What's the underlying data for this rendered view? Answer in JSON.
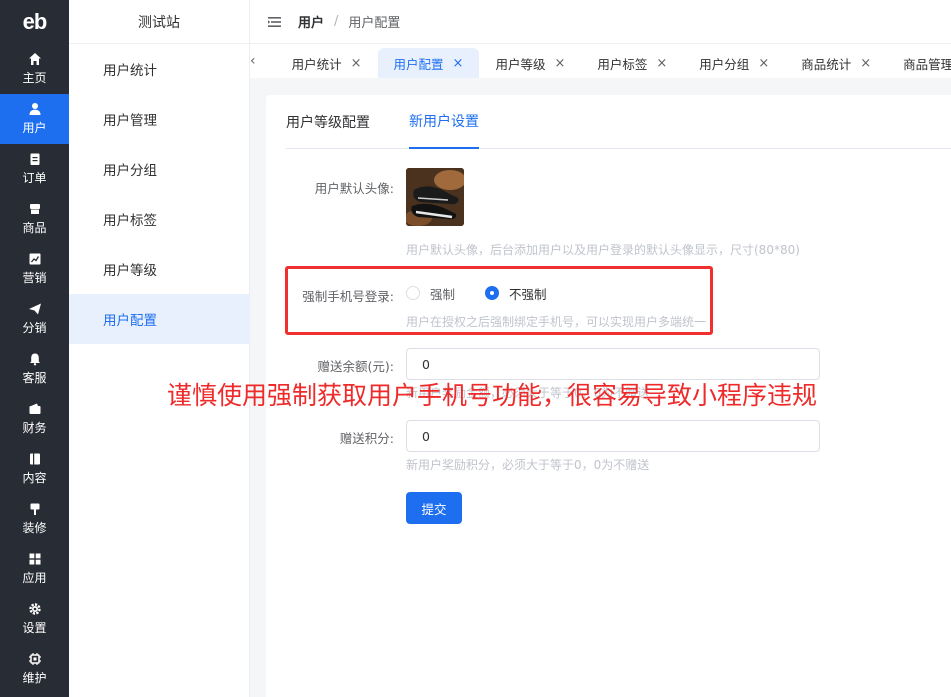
{
  "logo": {
    "text": "eb"
  },
  "rail": {
    "items": [
      {
        "label": "主页",
        "icon": "home-icon"
      },
      {
        "label": "用户",
        "icon": "user-icon",
        "active": true
      },
      {
        "label": "订单",
        "icon": "clipboard-icon"
      },
      {
        "label": "商品",
        "icon": "box-icon"
      },
      {
        "label": "营销",
        "icon": "chart-icon"
      },
      {
        "label": "分销",
        "icon": "send-icon"
      },
      {
        "label": "客服",
        "icon": "bell-icon"
      },
      {
        "label": "财务",
        "icon": "wallet-icon"
      },
      {
        "label": "内容",
        "icon": "book-icon"
      },
      {
        "label": "装修",
        "icon": "brush-icon"
      },
      {
        "label": "应用",
        "icon": "grid-icon"
      },
      {
        "label": "设置",
        "icon": "gear-icon"
      },
      {
        "label": "维护",
        "icon": "chip-icon"
      }
    ]
  },
  "submenu": {
    "title": "测试站",
    "items": [
      {
        "label": "用户统计"
      },
      {
        "label": "用户管理"
      },
      {
        "label": "用户分组"
      },
      {
        "label": "用户标签"
      },
      {
        "label": "用户等级"
      },
      {
        "label": "用户配置",
        "active": true
      }
    ]
  },
  "header": {
    "crumb_main": "用户",
    "crumb_sep": "/",
    "crumb_sub": "用户配置"
  },
  "tabs": [
    {
      "label": "用户统计"
    },
    {
      "label": "用户配置",
      "active": true
    },
    {
      "label": "用户等级"
    },
    {
      "label": "用户标签"
    },
    {
      "label": "用户分组"
    },
    {
      "label": "商品统计"
    },
    {
      "label": "商品管理"
    }
  ],
  "tab_close": "×",
  "tab_prev": "‹",
  "inner_tabs": [
    {
      "label": "用户等级配置"
    },
    {
      "label": "新用户设置",
      "active": true
    }
  ],
  "form": {
    "avatar_label": "用户默认头像:",
    "avatar_hint": "用户默认头像，后台添加用户以及用户登录的默认头像显示，尺寸(80*80)",
    "force_label": "强制手机号登录:",
    "force_options": [
      {
        "label": "强制",
        "checked": false
      },
      {
        "label": "不强制",
        "checked": true
      }
    ],
    "force_hint": "用户在授权之后强制绑定手机号，可以实现用户多端统一",
    "balance_label": "赠送余额(元):",
    "balance_value": "0",
    "balance_hint": "新用户奖励金额，必须大于等于0，0为不赠送",
    "points_label": "赠送积分:",
    "points_value": "0",
    "points_hint": "新用户奖励积分，必须大于等于0，0为不赠送",
    "submit_label": "提交"
  },
  "annotation": {
    "warning": "谨慎使用强制获取用户手机号功能，很容易导致小程序违规",
    "color": "#ee2a2a"
  },
  "colors": {
    "accent": "#1e6ff0",
    "rail_bg": "#282c34"
  }
}
